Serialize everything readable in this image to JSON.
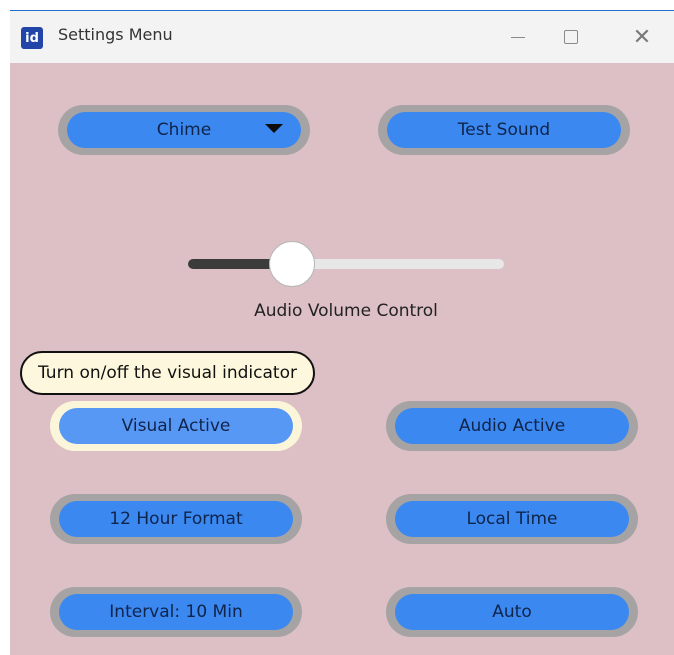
{
  "window": {
    "app_icon_text": "id",
    "title": "Settings Menu",
    "controls": {
      "minimize": "—",
      "maximize": "☐",
      "close": "✕"
    }
  },
  "sound_select": {
    "value": "Chime"
  },
  "test_sound": {
    "label": "Test Sound"
  },
  "volume": {
    "label": "Audio Volume Control",
    "level": 0.33
  },
  "tooltip": {
    "text": "Turn on/off the visual indicator"
  },
  "buttons": {
    "visual_active": "Visual Active",
    "audio_active": "Audio Active",
    "hour_format": "12 Hour Format",
    "local_time": "Local Time",
    "interval": "Interval: 10 Min",
    "auto": "Auto"
  },
  "icons": {
    "app": "app-icon",
    "minimize": "minimize-icon",
    "maximize": "maximize-icon",
    "close": "close-icon",
    "dropdown": "chevron-down-icon"
  },
  "colors": {
    "background": "#dcc0c5",
    "button_blue": "#3a88f0",
    "button_ring": "#a6a3a4",
    "active_ring": "#fbf6d9"
  }
}
